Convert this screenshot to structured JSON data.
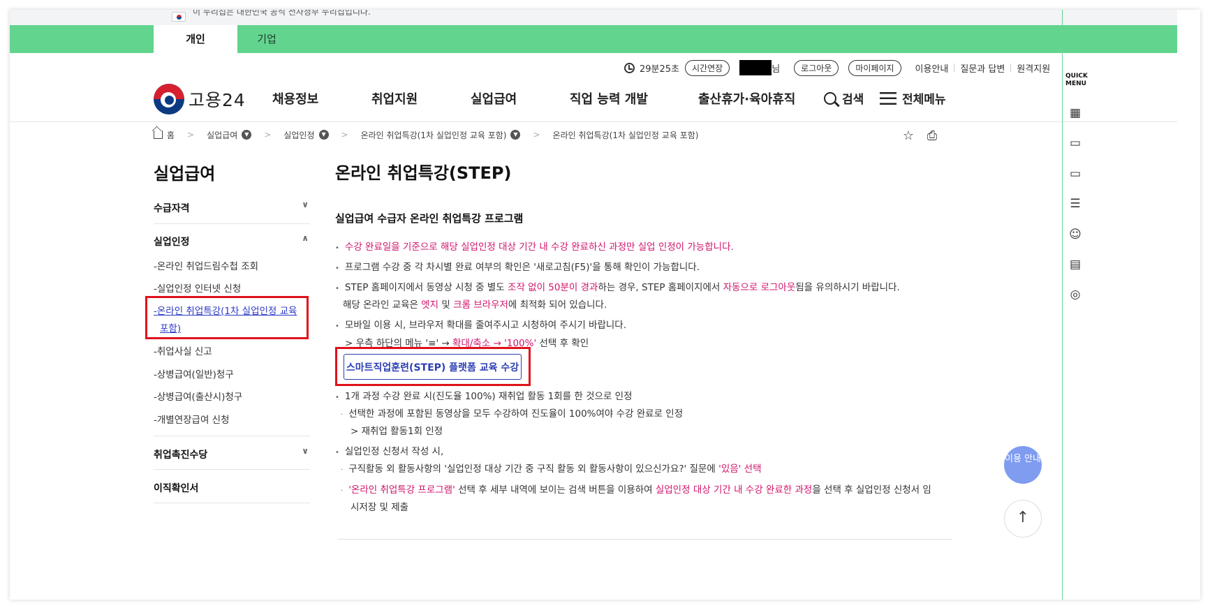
{
  "gov_notice": "이 누리집은 대한민국 공식 전자정부 누리집입니다.",
  "tabs": [
    "개인",
    "기업"
  ],
  "util": {
    "timer": "29분25초",
    "extend": "시간연장",
    "user_suffix": "님",
    "logout": "로그아웃",
    "mypage": "마이페이지",
    "guide": "이용안내",
    "qna": "질문과 답변",
    "remote": "원격지원"
  },
  "logo": "고용24",
  "gnb": [
    "채용정보",
    "취업지원",
    "실업급여",
    "직업 능력 개발",
    "출산휴가·육아휴직"
  ],
  "search_label": "검색",
  "menu_label": "전체메뉴",
  "breadcrumb": {
    "home": "홈",
    "c1": "실업급여",
    "c2": "실업인정",
    "c3": "온라인 취업특강(1차 실업인정 교육 포함)",
    "c4": "온라인 취업특강(1차 실업인정 교육 포함)"
  },
  "sidebar": {
    "title": "실업급여",
    "g1": "수급자격",
    "g2": "실업인정",
    "subs": [
      "-온라인 취업드림수첩 조회",
      "-실업인정 인터넷 신청",
      "-온라인 취업특강(1차 실업인정 교육",
      "포함)",
      "-취업사실 신고",
      "-상병급여(일반)청구",
      "-상병급여(출산시)청구",
      "-개별연장급여 신청"
    ],
    "g3": "취업촉진수당",
    "g4": "이직확인서"
  },
  "content": {
    "title": "온라인 취업특강(STEP)",
    "subtitle": "실업급여 수급자 온라인 취업특강 프로그램",
    "b1": "수강 완료일을 기준으로 해당 실업인정 대상 기간 내 수강 완료하신 과정만 실업 인정이 가능합니다.",
    "b2": "프로그램 수강 중 각 차시별 완료 여부의 확인은 '새로고침(F5)'을 통해 확인이 가능합니다.",
    "b3a": "STEP 홈페이지에서 동영상 시청 중 별도 ",
    "b3b": "조작 없이 50분이 경과",
    "b3c": "하는 경우, STEP 홈페이지에서 ",
    "b3d": "자동으로 로그아웃",
    "b3e": "됨을 유의하시기 바랍니다.",
    "b3f": "해당 온라인 교육은 ",
    "b3g": "엣지",
    "b3h": " 및 ",
    "b3i": "크롬 브라우저",
    "b3j": "에 최적화 되어 있습니다.",
    "b4": "모바일 이용 시, 브라우저 확대를 줄여주시고 시청하여 주시기 바랍니다.",
    "b4a": "> 우측 하단의 메뉴 '≡' → ",
    "b4b": "확대/축소 → '100%'",
    "b4c": " 선택 후 확인",
    "step_button": "스마트직업훈련(STEP) 플랫폼 교육 수강",
    "b5": "1개 과정 수강 완료 시(진도율 100%) 재취업 활동 1회를 한 것으로 인정",
    "b5a": "선택한 과정에 포함된 동영상을 모두 수강하여 진도율이 100%여야 수강 완료로 인정",
    "b5b": "> 재취업 활동1회 인정",
    "b6": "실업인정 신청서 작성 시,",
    "b6a": "구직활동 외 활동사항의 '실업인정 대상 기간 중 구직 활동 외 활동사항이 있으신가요?' 질문에 ",
    "b6b": "'있음' 선택",
    "b6c": "'온라인 취업특강 프로그램'",
    "b6d": " 선택 후 세부 내역에 보이는 검색 버튼을 이용하여 ",
    "b6e": "실업인정 대상 기간 내 수강 완료한 과정",
    "b6f": "을 선택 후 실업인정 신청서 임",
    "b6g": "시저장 및 제출"
  },
  "quick_menu": "QUICK MENU",
  "help_label": "이용 안내",
  "colors": {
    "accent_green": "#63d48e",
    "highlight": "#d0156c",
    "button_blue": "#2c3fb3",
    "annotation_red": "#e0111b"
  }
}
